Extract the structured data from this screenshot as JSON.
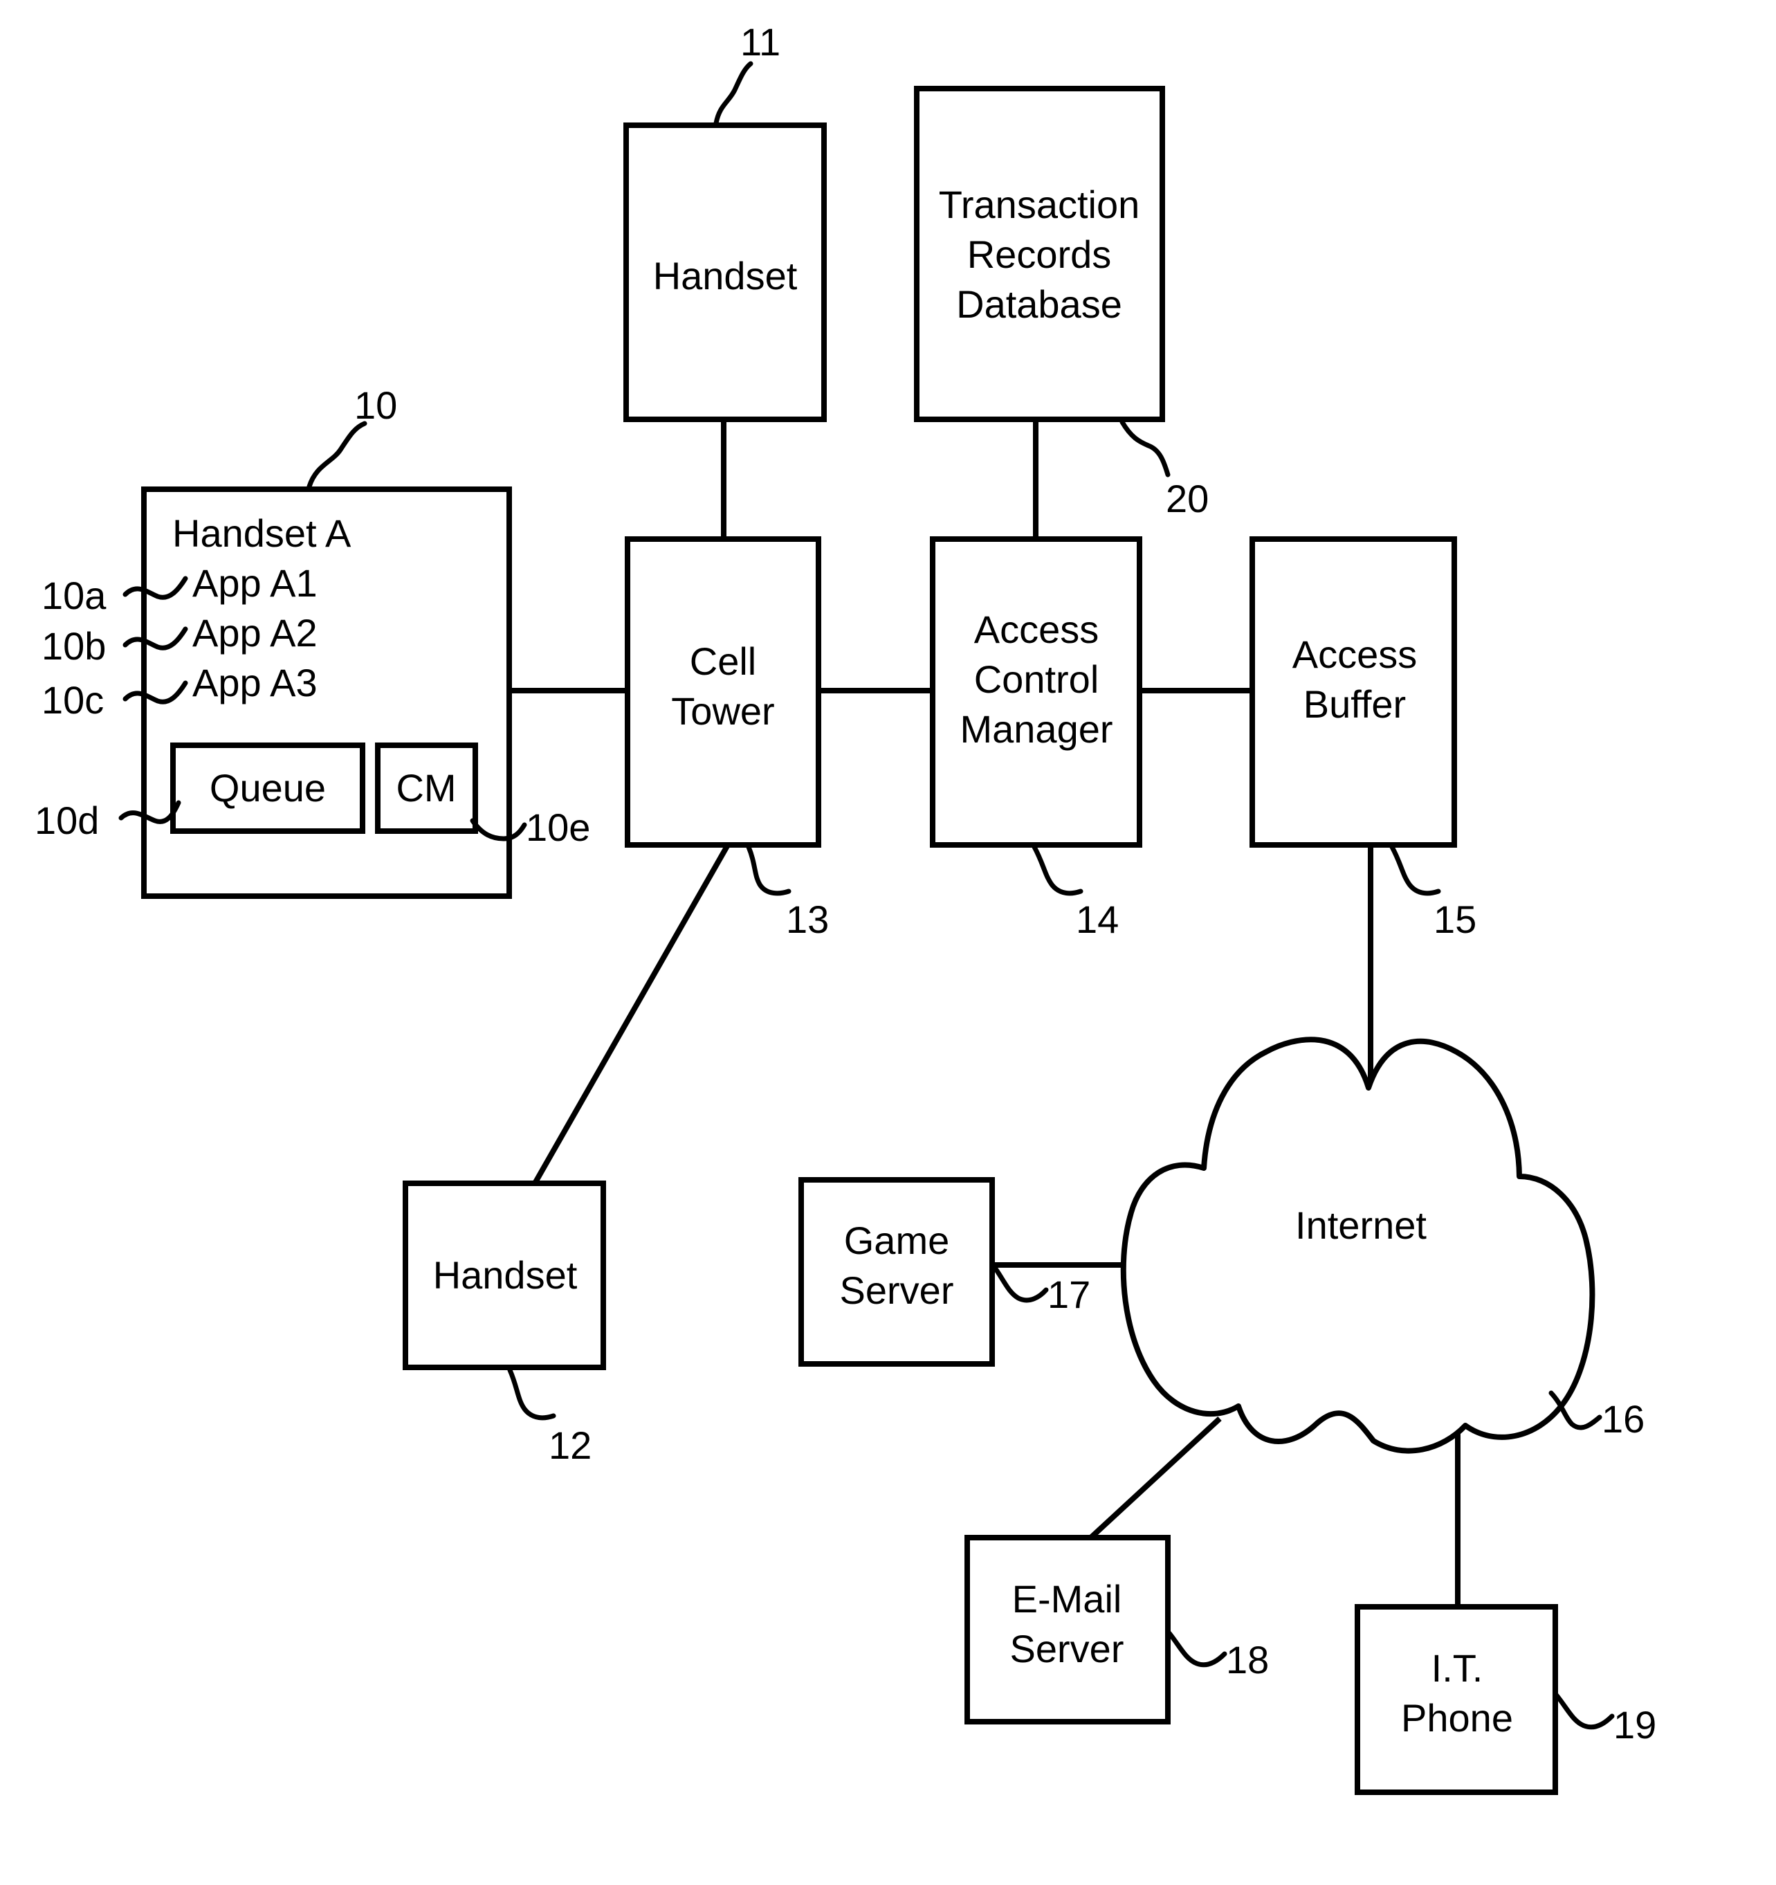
{
  "figure": {
    "type": "patent-block-diagram",
    "background": "#ffffff",
    "line_color": "#000000"
  },
  "nodes": {
    "handset_a": {
      "title": "Handset A",
      "apps": [
        "App A1",
        "App A2",
        "App A3"
      ],
      "queue_label": "Queue",
      "cm_label": "CM",
      "ref": "10",
      "app_refs": [
        "10a",
        "10b",
        "10c"
      ],
      "queue_ref": "10d",
      "cm_ref": "10e"
    },
    "handset_11": {
      "label": "Handset",
      "ref": "11"
    },
    "handset_12": {
      "label": "Handset",
      "ref": "12"
    },
    "transaction_db": {
      "line1": "Transaction",
      "line2": "Records",
      "line3": "Database",
      "ref": "20"
    },
    "cell_tower": {
      "line1": "Cell",
      "line2": "Tower",
      "ref": "13"
    },
    "access_control_manager": {
      "line1": "Access",
      "line2": "Control",
      "line3": "Manager",
      "ref": "14"
    },
    "access_buffer": {
      "line1": "Access",
      "line2": "Buffer",
      "ref": "15"
    },
    "internet": {
      "label": "Internet",
      "ref": "16"
    },
    "game_server": {
      "line1": "Game",
      "line2": "Server",
      "ref": "17"
    },
    "email_server": {
      "line1": "E-Mail",
      "line2": "Server",
      "ref": "18"
    },
    "it_phone": {
      "line1": "I.T.",
      "line2": "Phone",
      "ref": "19"
    }
  },
  "connections": [
    {
      "from": "handset_a",
      "to": "cell_tower"
    },
    {
      "from": "handset_11",
      "to": "cell_tower"
    },
    {
      "from": "handset_12",
      "to": "cell_tower"
    },
    {
      "from": "cell_tower",
      "to": "access_control_manager"
    },
    {
      "from": "transaction_db",
      "to": "access_control_manager"
    },
    {
      "from": "access_control_manager",
      "to": "access_buffer"
    },
    {
      "from": "access_buffer",
      "to": "internet"
    },
    {
      "from": "game_server",
      "to": "internet"
    },
    {
      "from": "email_server",
      "to": "internet"
    },
    {
      "from": "it_phone",
      "to": "internet"
    }
  ]
}
